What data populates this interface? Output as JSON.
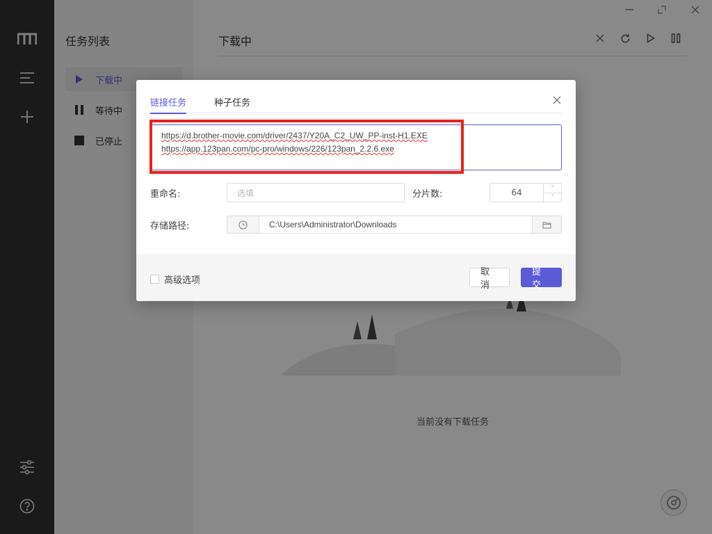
{
  "window": {
    "minimize_icon": "minimize-icon",
    "maximize_icon": "maximize-icon",
    "close_icon": "close-icon"
  },
  "sidebar": {
    "title": "任务列表",
    "items": [
      {
        "label": "下载中",
        "icon": "play-icon",
        "active": true
      },
      {
        "label": "等待中",
        "icon": "pause-icon",
        "active": false
      },
      {
        "label": "已停止",
        "icon": "stop-icon",
        "active": false
      }
    ]
  },
  "main": {
    "title": "下载中",
    "empty_text": "当前没有下载任务"
  },
  "dialog": {
    "tabs": [
      {
        "label": "链接任务",
        "active": true
      },
      {
        "label": "种子任务",
        "active": false
      }
    ],
    "urls": [
      "https://d.brother-movie.com/driver/2437/Y20A_C2_UW_PP-inst-H1.EXE",
      "https://app.123pan.com/pc-pro/windows/226/123pan_2.2.6.exe"
    ],
    "rename_label": "重命名:",
    "rename_placeholder": "选填",
    "split_label": "分片数:",
    "split_value": "64",
    "path_label": "存储路径:",
    "path_value": "C:\\Users\\Administrator\\Downloads",
    "advanced_label": "高级选项",
    "cancel_label": "取 消",
    "submit_label": "提 交"
  },
  "colors": {
    "accent": "#5b5bd6",
    "highlight": "#e8231b",
    "rail": "#313131"
  }
}
